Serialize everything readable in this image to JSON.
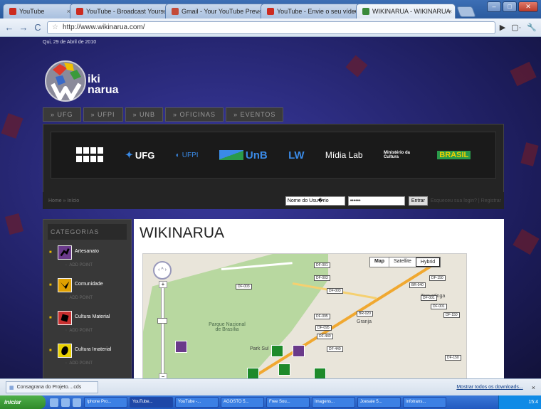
{
  "browser": {
    "tabs": [
      {
        "label": "YouTube",
        "color": "#cc2b1f",
        "active": false
      },
      {
        "label": "YouTube - Broadcast Yours...",
        "color": "#cc2b1f",
        "active": false
      },
      {
        "label": "Gmail - Your YouTube Prev...",
        "color": "#c44a38",
        "active": false
      },
      {
        "label": "YouTube - Envie o seu vídeo",
        "color": "#cc2b1f",
        "active": false
      },
      {
        "label": "WIKINARUA - WIKINARUA",
        "color": "#3a8a3a",
        "active": true
      }
    ],
    "url": "http://www.wikinarua.com/",
    "tab_close": "×"
  },
  "page": {
    "date": "Qui, 29 de Abril de 2010",
    "brand_line1": "iki",
    "brand_line2": "narua",
    "nav": [
      "» UFG",
      "» UFPI",
      "» UNB",
      "» OFICINAS",
      "» EVENTOS"
    ],
    "sponsors": [
      "UFG",
      "UFPI",
      "UnB",
      "LW",
      "Mídia Lab",
      "Ministério da Cultura",
      "BRASIL"
    ],
    "breadcrumb": "Home » Início",
    "login": {
      "username_value": "Nome do Usu�rio",
      "password_value": "••••••",
      "submit": "Entrar",
      "register": "Esqueceu sua login? | Registrar"
    },
    "sidebar": {
      "title": "CATEGORIAS",
      "add_label": "ADD POINT",
      "items": [
        {
          "label": "Artesanato",
          "color": "#6a3a8a"
        },
        {
          "label": "Comunidade",
          "color": "#e0a000"
        },
        {
          "label": "Cultura Material",
          "color": "#c83030"
        },
        {
          "label": "Cultura Imaterial",
          "color": "#e8d000"
        }
      ]
    },
    "main_title": "WIKINARUA",
    "map": {
      "types": [
        "Map",
        "Satellite",
        "Hybrid"
      ],
      "park_label": "Parque Nacional de Brasília",
      "places": [
        "Park Sul",
        "Granja",
        "Taguatinga"
      ],
      "shields": [
        "DF-003",
        "DF-003",
        "DF-003",
        "DF-095",
        "DF-095",
        "BR-020",
        "BR-040",
        "DF-001",
        "DF-001",
        "DF-150",
        "DF-150",
        "DF-440",
        "DF-440",
        "DF-001",
        "DF-150"
      ],
      "nav_glyph": "‹ ^ ›",
      "zoom_in": "+",
      "zoom_out": "−"
    }
  },
  "status": {
    "download_item": "Consagrana do Projeto....cds",
    "show_all": "Mostrar todos os downloads...",
    "close": "×"
  },
  "taskbar": {
    "start": "iniciar",
    "items": [
      "Iphone Pro...",
      "YouTube...",
      "YouTube -...",
      "AGOSTO 5...",
      "Free Sou...",
      "Imagens...",
      "Joesale 5...",
      "Infotrans..."
    ],
    "clock": "15:4"
  }
}
